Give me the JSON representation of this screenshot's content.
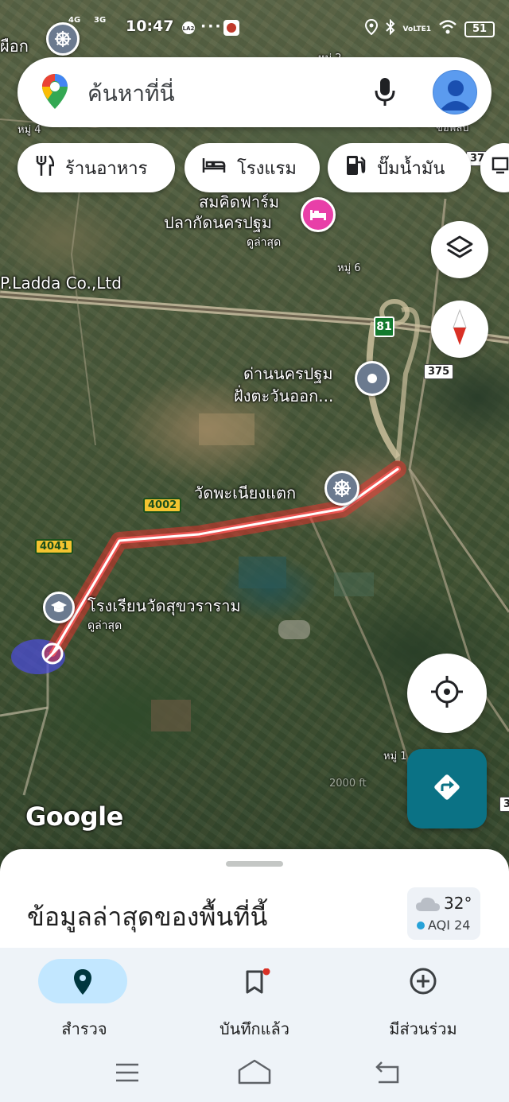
{
  "status_bar": {
    "time": "10:47",
    "network_3g": "3G",
    "network_4g": "4G",
    "volte": "VoLTE1",
    "battery": "51"
  },
  "search": {
    "placeholder": "ค้นหาที่นี่",
    "mic_icon": "mic-icon",
    "avatar_icon": "account-avatar-icon"
  },
  "chips": [
    {
      "label": "ร้านอาหาร",
      "icon": "restaurant-icon"
    },
    {
      "label": "โรงแรม",
      "icon": "hotel-icon"
    },
    {
      "label": "ปั๊มน้ำมัน",
      "icon": "gas-station-icon"
    }
  ],
  "map": {
    "labels": {
      "top_left_partial": "ผือก",
      "moo2": "หมู่ 2",
      "moo4": "หมู่ 4",
      "moo6": "หมู่ 6",
      "moo1": "หมู่ 1",
      "right_partial": "ขอพลบ",
      "farm_line1": "สมคิดฟาร์ม",
      "farm_line2": "ปลากัดนครปฐม",
      "farm_sub": "ดูล่าสุด",
      "company": "P.Ladda Co.,Ltd",
      "toll_line1": "ด่านนครปฐม",
      "toll_line2": "ฝั่งตะวันออก...",
      "temple": "วัดพะเนียงแตก",
      "school": "โรงเรียนวัดสุขวราราม",
      "school_sub": "ดูล่าสุด",
      "scale_partial": "2000 ft"
    },
    "shields": {
      "r81": "81",
      "r375": "375",
      "r4002": "4002",
      "r4041": "4041",
      "r37": "37",
      "r3": "3"
    },
    "brand": "Google",
    "route_color": "#ff3b3b",
    "accent_teal": "#0b7285"
  },
  "sheet": {
    "title": "ข้อมูลล่าสุดของพื้นที่นี้",
    "weather_temp": "32°",
    "weather_aqi": "AQI 24",
    "weather_icon": "cloud-icon"
  },
  "nav": [
    {
      "label": "สำรวจ",
      "icon": "explore-pin-icon",
      "active": true
    },
    {
      "label": "บันทึกแล้ว",
      "icon": "bookmark-icon",
      "active": false
    },
    {
      "label": "มีส่วนร่วม",
      "icon": "add-circle-icon",
      "active": false
    }
  ],
  "system_nav": [
    "menu-icon",
    "home-icon",
    "back-icon"
  ]
}
